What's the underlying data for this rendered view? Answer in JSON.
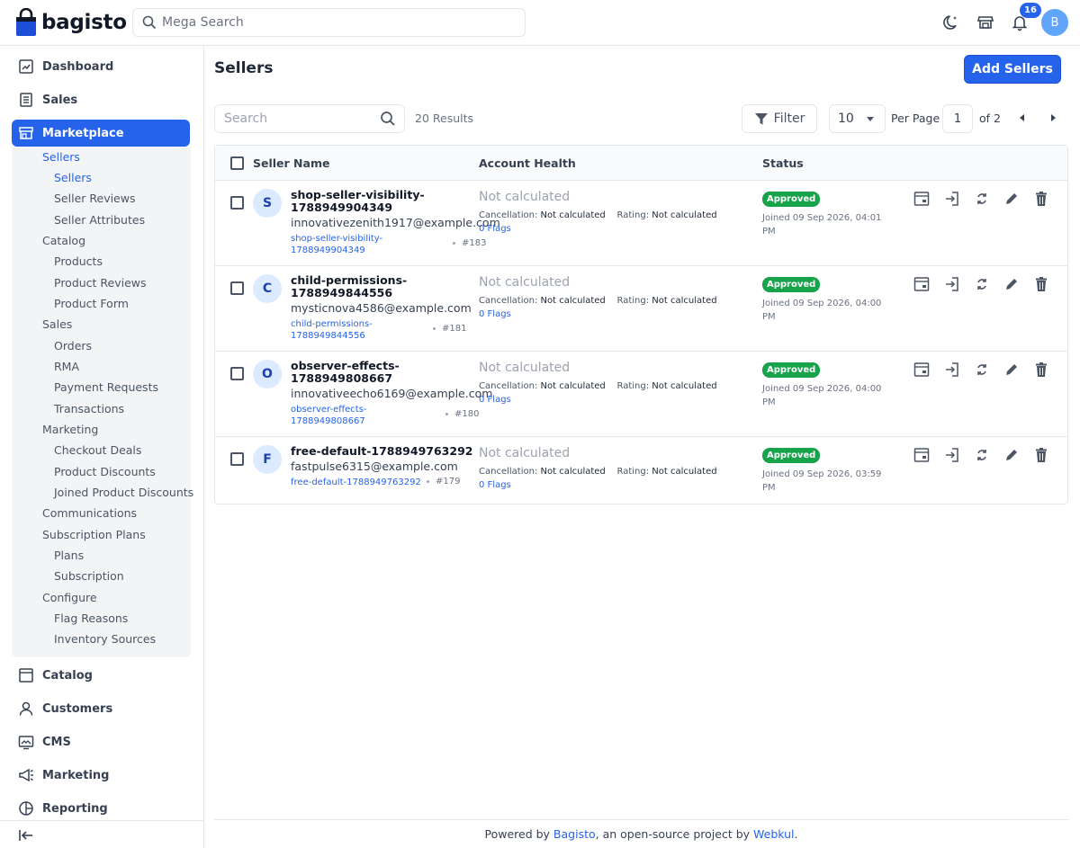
{
  "header": {
    "logo_text": "bagisto",
    "search_placeholder": "Mega Search",
    "notification_count": "16",
    "avatar_initial": "B",
    "icons": [
      "dark-mode-icon",
      "storefront-icon",
      "bell-icon"
    ]
  },
  "sidebar": {
    "top": [
      {
        "label": "Dashboard",
        "icon": "dashboard-icon"
      },
      {
        "label": "Sales",
        "icon": "sales-icon"
      },
      {
        "label": "Marketplace",
        "icon": "marketplace-icon"
      }
    ],
    "marketplace_sub": [
      {
        "label": "Sellers",
        "level": 1,
        "active": true
      },
      {
        "label": "Sellers",
        "level": 2,
        "active": true
      },
      {
        "label": "Seller Reviews",
        "level": 2
      },
      {
        "label": "Seller Attributes",
        "level": 2
      },
      {
        "label": "Catalog",
        "level": 1
      },
      {
        "label": "Products",
        "level": 2
      },
      {
        "label": "Product Reviews",
        "level": 2
      },
      {
        "label": "Product Form",
        "level": 2
      },
      {
        "label": "Sales",
        "level": 1
      },
      {
        "label": "Orders",
        "level": 2
      },
      {
        "label": "RMA",
        "level": 2
      },
      {
        "label": "Payment Requests",
        "level": 2
      },
      {
        "label": "Transactions",
        "level": 2
      },
      {
        "label": "Marketing",
        "level": 1
      },
      {
        "label": "Checkout Deals",
        "level": 2
      },
      {
        "label": "Product Discounts",
        "level": 2
      },
      {
        "label": "Joined Product Discounts",
        "level": 2
      },
      {
        "label": "Communications",
        "level": 1
      },
      {
        "label": "Subscription Plans",
        "level": 1
      },
      {
        "label": "Plans",
        "level": 2
      },
      {
        "label": "Subscription",
        "level": 2
      },
      {
        "label": "Configure",
        "level": 1
      },
      {
        "label": "Flag Reasons",
        "level": 2
      },
      {
        "label": "Inventory Sources",
        "level": 2
      }
    ],
    "bottom": [
      {
        "label": "Catalog",
        "icon": "catalog-icon"
      },
      {
        "label": "Customers",
        "icon": "customers-icon"
      },
      {
        "label": "CMS",
        "icon": "cms-icon"
      },
      {
        "label": "Marketing",
        "icon": "marketing-icon"
      },
      {
        "label": "Reporting",
        "icon": "reporting-icon"
      }
    ]
  },
  "main": {
    "title": "Sellers",
    "add_button": "Add Sellers",
    "search_placeholder": "Search",
    "results": "20 Results",
    "filter_label": "Filter",
    "per_page_value": "10",
    "per_page_label": "Per Page",
    "page_current": "1",
    "page_total_label": "of 2",
    "columns": [
      "Seller Name",
      "Account Health",
      "Status"
    ],
    "sellers": [
      {
        "initial": "S",
        "name": "shop-seller-visibility-1788949904349",
        "email": "innovativezenith1917@example.com",
        "url_slug": "shop-seller-visibility-1788949904349",
        "id": "#183",
        "health": "Not calculated",
        "cancellation_label": "Cancellation:",
        "cancellation_value": "Not calculated",
        "rating_label": "Rating:",
        "rating_value": "Not calculated",
        "flags": "0 Flags",
        "status": "Approved",
        "joined": "Joined 09 Sep 2026, 04:01 PM"
      },
      {
        "initial": "C",
        "name": "child-permissions-1788949844556",
        "email": "mysticnova4586@example.com",
        "url_slug": "child-permissions-1788949844556",
        "id": "#181",
        "health": "Not calculated",
        "cancellation_label": "Cancellation:",
        "cancellation_value": "Not calculated",
        "rating_label": "Rating:",
        "rating_value": "Not calculated",
        "flags": "0 Flags",
        "status": "Approved",
        "joined": "Joined 09 Sep 2026, 04:00 PM"
      },
      {
        "initial": "O",
        "name": "observer-effects-1788949808667",
        "email": "innovativeecho6169@example.com",
        "url_slug": "observer-effects-1788949808667",
        "id": "#180",
        "health": "Not calculated",
        "cancellation_label": "Cancellation:",
        "cancellation_value": "Not calculated",
        "rating_label": "Rating:",
        "rating_value": "Not calculated",
        "flags": "0 Flags",
        "status": "Approved",
        "joined": "Joined 09 Sep 2026, 04:00 PM"
      },
      {
        "initial": "F",
        "name": "free-default-1788949763292",
        "email": "fastpulse6315@example.com",
        "url_slug": "free-default-1788949763292",
        "id": "#179",
        "health": "Not calculated",
        "cancellation_label": "Cancellation:",
        "cancellation_value": "Not calculated",
        "rating_label": "Rating:",
        "rating_value": "Not calculated",
        "flags": "0 Flags",
        "status": "Approved",
        "joined": "Joined 09 Sep 2026, 03:59 PM"
      }
    ],
    "row_actions": [
      "view-icon",
      "login-as-seller-icon",
      "sync-icon",
      "edit-icon",
      "delete-icon"
    ]
  },
  "footer": {
    "prefix": "Powered by ",
    "link1": "Bagisto",
    "middle": ", an open-source project by ",
    "link2": "Webkul",
    "suffix": "."
  },
  "colors": {
    "primary": "#2563eb",
    "approved": "#16a34a",
    "muted_text": "#9ca3af"
  }
}
